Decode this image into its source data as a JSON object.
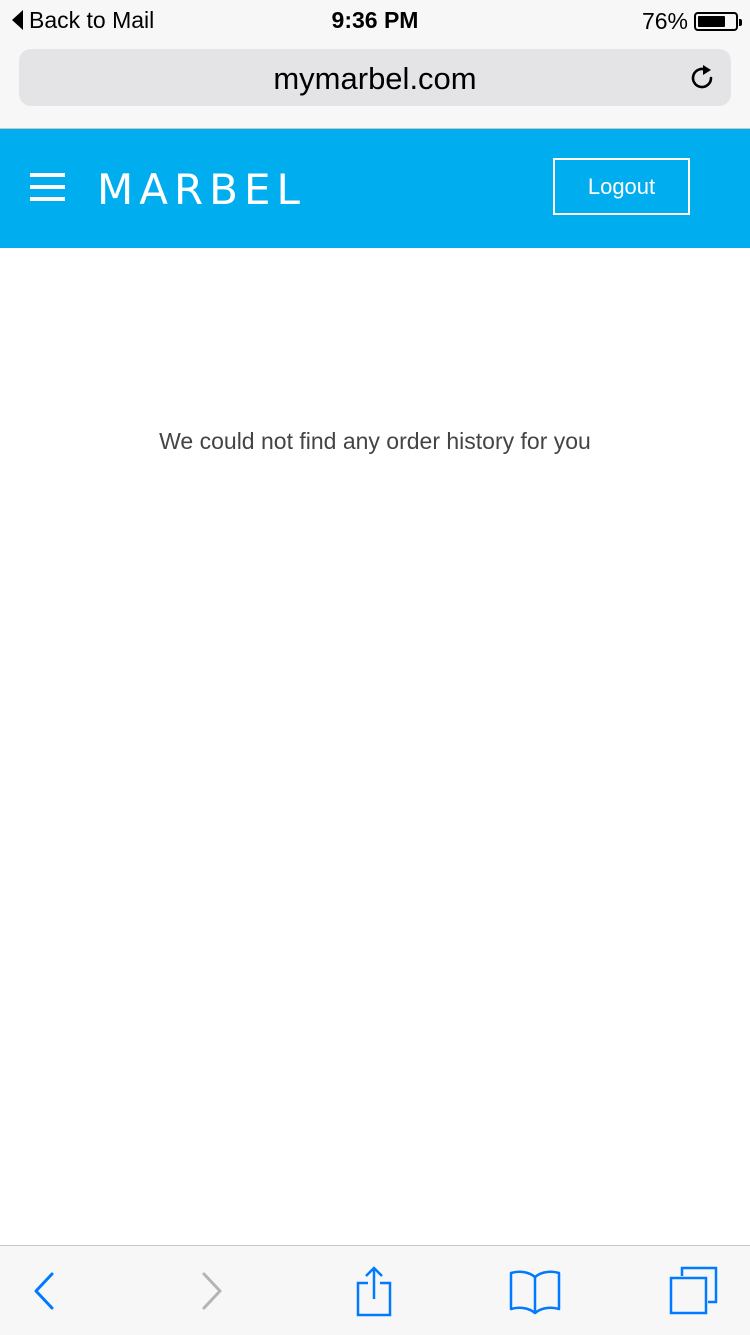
{
  "status_bar": {
    "back_label": "Back to Mail",
    "time": "9:36 PM",
    "battery_percent": "76%",
    "battery_level": 0.76
  },
  "browser": {
    "url": "mymarbel.com",
    "reload_icon": "reload-icon"
  },
  "header": {
    "menu_icon": "hamburger-menu-icon",
    "logo_text": "MARBEL",
    "logout_label": "Logout",
    "background_color": "#00aeef"
  },
  "main": {
    "empty_message": "We could not find any order history for you"
  },
  "toolbar": {
    "icons": [
      "back-arrow-icon",
      "forward-arrow-icon",
      "share-icon",
      "bookmarks-icon",
      "tabs-icon"
    ],
    "accent_color": "#007aff",
    "disabled_color": "#b4b4b4"
  }
}
